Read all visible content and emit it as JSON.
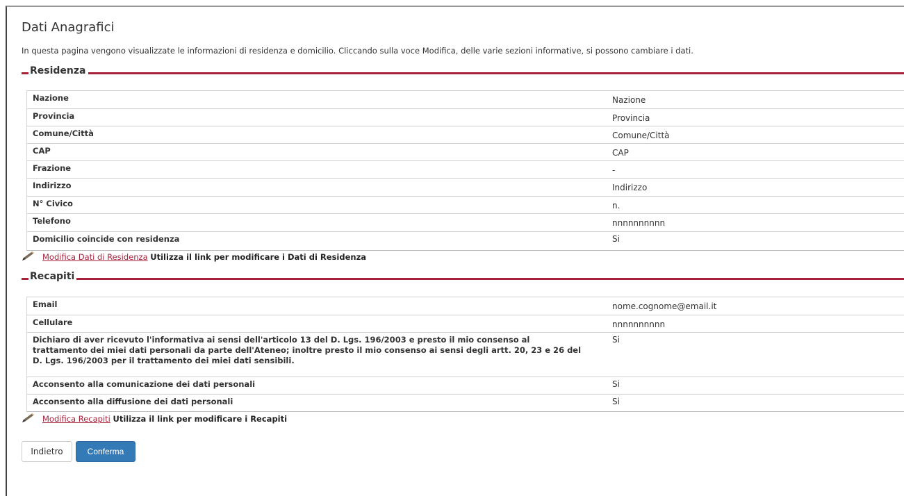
{
  "page": {
    "title": "Dati Anagrafici",
    "intro": "In questa pagina vengono visualizzate le informazioni di residenza e domicilio. Cliccando sulla voce Modifica, delle varie sezioni informative, si possono cambiare i dati."
  },
  "residenza": {
    "title": "Residenza",
    "rows": [
      {
        "label": "Nazione",
        "value": "Nazione"
      },
      {
        "label": "Provincia",
        "value": "Provincia"
      },
      {
        "label": "Comune/Città",
        "value": "Comune/Città"
      },
      {
        "label": "CAP",
        "value": "CAP"
      },
      {
        "label": "Frazione",
        "value": "-"
      },
      {
        "label": "Indirizzo",
        "value": "Indirizzo"
      },
      {
        "label": "N° Civico",
        "value": "n."
      },
      {
        "label": "Telefono",
        "value": "nnnnnnnnnn"
      },
      {
        "label": "Domicilio coincide con residenza",
        "value": "Si"
      }
    ],
    "edit_link": "Modifica Dati di Residenza",
    "edit_hint": "Utilizza il link per modificare i Dati di Residenza"
  },
  "recapiti": {
    "title": "Recapiti",
    "rows": [
      {
        "label": "Email",
        "value": "nome.cognome@email.it"
      },
      {
        "label": "Cellulare",
        "value": "nnnnnnnnnn"
      },
      {
        "label": "Dichiaro di aver ricevuto l'informativa ai sensi dell'articolo 13 del D. Lgs. 196/2003 e presto il mio consenso al trattamento dei miei dati personali da parte dell'Ateneo; inoltre presto il mio consenso ai sensi degli artt. 20, 23 e 26 del D. Lgs. 196/2003 per il trattamento dei miei dati sensibili.",
        "value": "Si"
      },
      {
        "label": "Acconsento alla comunicazione dei dati personali",
        "value": "Si"
      },
      {
        "label": "Acconsento alla diffusione dei dati personali",
        "value": "Si"
      }
    ],
    "edit_link": "Modifica Recapiti",
    "edit_hint": "Utilizza il link per modificare i Recapiti"
  },
  "buttons": {
    "back": "Indietro",
    "confirm": "Conferma"
  },
  "colors": {
    "accent": "#a8213a",
    "primary_button": "#337ab7"
  }
}
